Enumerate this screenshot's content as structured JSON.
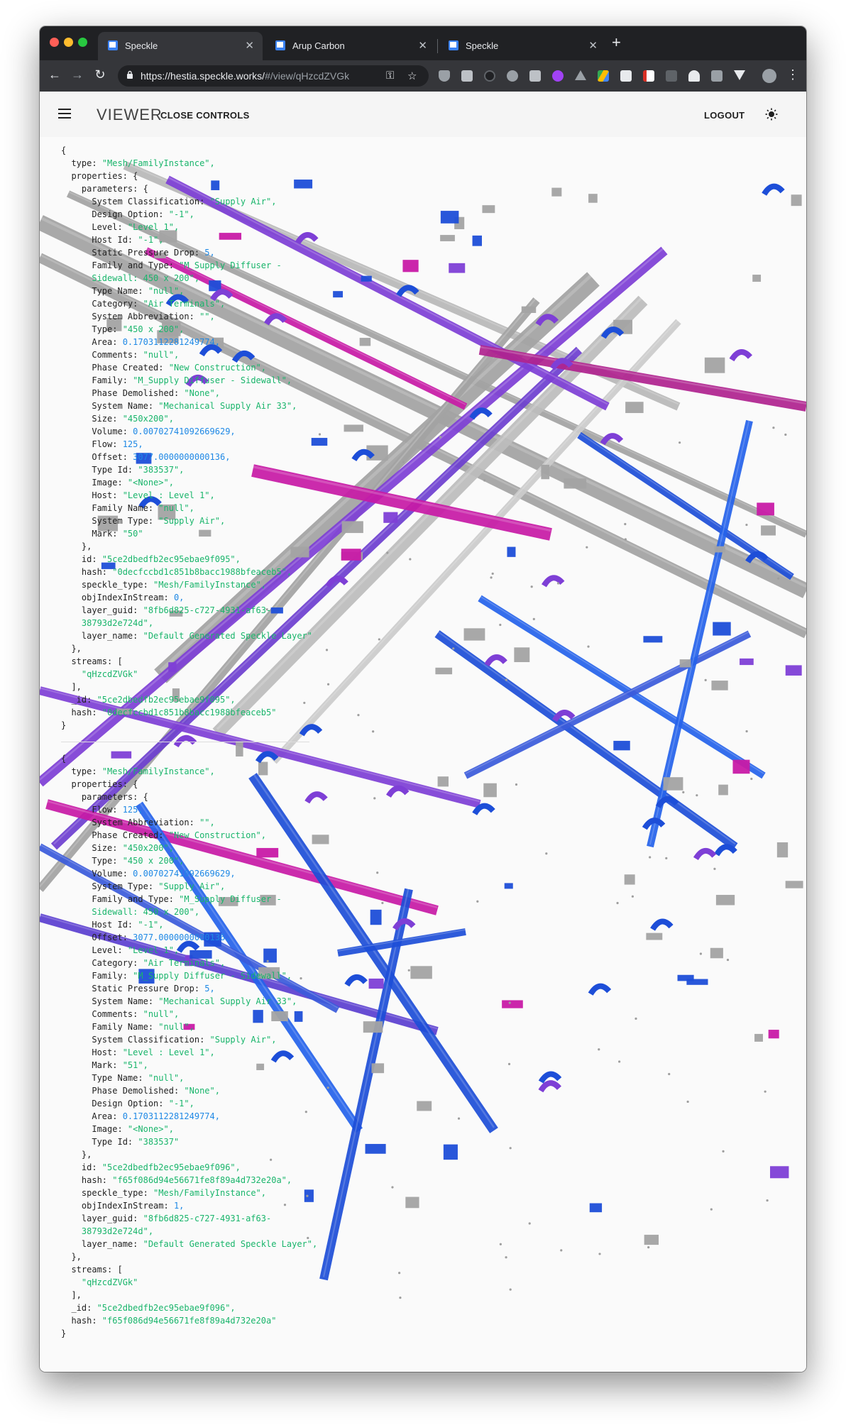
{
  "browser": {
    "tabs": [
      {
        "title": "Speckle",
        "active": true
      },
      {
        "title": "Arup Carbon",
        "active": false
      },
      {
        "title": "Speckle",
        "active": false
      }
    ],
    "url_main": "https://hestia.speckle.works/",
    "url_rest": "#/view/qHzcdZVGk"
  },
  "appbar": {
    "title": "VIEWER",
    "close_controls": "CLOSE CONTROLS",
    "logout": "LOGOUT"
  },
  "colors": {
    "accent": "#1e88e5",
    "string_value": "#19b56b",
    "duct_blue": "#1d4ed8",
    "duct_purple": "#7e3fd6",
    "duct_magenta": "#c81aa6",
    "duct_gray": "#a3a3a3"
  },
  "objects": [
    {
      "lines": [
        [
          {
            "t": "p",
            "v": "{"
          }
        ],
        [
          {
            "t": "k",
            "v": "  type: "
          },
          {
            "t": "s",
            "v": "\"Mesh/FamilyInstance\","
          }
        ],
        [
          {
            "t": "k",
            "v": "  properties: {"
          }
        ],
        [
          {
            "t": "k",
            "v": "    parameters: {"
          }
        ],
        [
          {
            "t": "k",
            "v": "      System Classification: "
          },
          {
            "t": "s",
            "v": "\"Supply Air\","
          }
        ],
        [
          {
            "t": "k",
            "v": "      Design Option: "
          },
          {
            "t": "s",
            "v": "\"-1\","
          }
        ],
        [
          {
            "t": "k",
            "v": "      Level: "
          },
          {
            "t": "s",
            "v": "\"Level 1\","
          }
        ],
        [
          {
            "t": "k",
            "v": "      Host Id: "
          },
          {
            "t": "s",
            "v": "\"-1\","
          }
        ],
        [
          {
            "t": "k",
            "v": "      Static Pressure Drop: "
          },
          {
            "t": "n",
            "v": "5,"
          }
        ],
        [
          {
            "t": "k",
            "v": "      Family and Type: "
          },
          {
            "t": "s",
            "v": "\"M_Supply Diffuser -"
          }
        ],
        [
          {
            "t": "s",
            "v": "      Sidewall: 450 x 200\","
          }
        ],
        [
          {
            "t": "k",
            "v": "      Type Name: "
          },
          {
            "t": "s",
            "v": "\"null\","
          }
        ],
        [
          {
            "t": "k",
            "v": "      Category: "
          },
          {
            "t": "s",
            "v": "\"Air Terminals\","
          }
        ],
        [
          {
            "t": "k",
            "v": "      System Abbreviation: "
          },
          {
            "t": "s",
            "v": "\"\","
          }
        ],
        [
          {
            "t": "k",
            "v": "      Type: "
          },
          {
            "t": "s",
            "v": "\"450 x 200\","
          }
        ],
        [
          {
            "t": "k",
            "v": "      Area: "
          },
          {
            "t": "n",
            "v": "0.1703112281249774,"
          }
        ],
        [
          {
            "t": "k",
            "v": "      Comments: "
          },
          {
            "t": "s",
            "v": "\"null\","
          }
        ],
        [
          {
            "t": "k",
            "v": "      Phase Created: "
          },
          {
            "t": "s",
            "v": "\"New Construction\","
          }
        ],
        [
          {
            "t": "k",
            "v": "      Family: "
          },
          {
            "t": "s",
            "v": "\"M_Supply Diffuser - Sidewall\","
          }
        ],
        [
          {
            "t": "k",
            "v": "      Phase Demolished: "
          },
          {
            "t": "s",
            "v": "\"None\","
          }
        ],
        [
          {
            "t": "k",
            "v": "      System Name: "
          },
          {
            "t": "s",
            "v": "\"Mechanical Supply Air 33\","
          }
        ],
        [
          {
            "t": "k",
            "v": "      Size: "
          },
          {
            "t": "s",
            "v": "\"450x200\","
          }
        ],
        [
          {
            "t": "k",
            "v": "      Volume: "
          },
          {
            "t": "n",
            "v": "0.00702741092669629,"
          }
        ],
        [
          {
            "t": "k",
            "v": "      Flow: "
          },
          {
            "t": "n",
            "v": "125,"
          }
        ],
        [
          {
            "t": "k",
            "v": "      Offset: "
          },
          {
            "t": "n",
            "v": "3077.0000000000136,"
          }
        ],
        [
          {
            "t": "k",
            "v": "      Type Id: "
          },
          {
            "t": "s",
            "v": "\"383537\","
          }
        ],
        [
          {
            "t": "k",
            "v": "      Image: "
          },
          {
            "t": "s",
            "v": "\"<None>\","
          }
        ],
        [
          {
            "t": "k",
            "v": "      Host: "
          },
          {
            "t": "s",
            "v": "\"Level : Level 1\","
          }
        ],
        [
          {
            "t": "k",
            "v": "      Family Name: "
          },
          {
            "t": "s",
            "v": "\"null\","
          }
        ],
        [
          {
            "t": "k",
            "v": "      System Type: "
          },
          {
            "t": "s",
            "v": "\"Supply Air\","
          }
        ],
        [
          {
            "t": "k",
            "v": "      Mark: "
          },
          {
            "t": "s",
            "v": "\"50\""
          }
        ],
        [
          {
            "t": "k",
            "v": "    },"
          }
        ],
        [
          {
            "t": "k",
            "v": "    id: "
          },
          {
            "t": "s",
            "v": "\"5ce2dbedfb2ec95ebae9f095\","
          }
        ],
        [
          {
            "t": "k",
            "v": "    hash: "
          },
          {
            "t": "s",
            "v": "\"0decfccbd1c851b8bacc1988bfeaceb5\","
          }
        ],
        [
          {
            "t": "k",
            "v": "    speckle_type: "
          },
          {
            "t": "s",
            "v": "\"Mesh/FamilyInstance\","
          }
        ],
        [
          {
            "t": "k",
            "v": "    objIndexInStream: "
          },
          {
            "t": "n",
            "v": "0,"
          }
        ],
        [
          {
            "t": "k",
            "v": "    layer_guid: "
          },
          {
            "t": "s",
            "v": "\"8fb6d825-c727-4931-af63-"
          }
        ],
        [
          {
            "t": "s",
            "v": "    38793d2e724d\","
          }
        ],
        [
          {
            "t": "k",
            "v": "    layer_name: "
          },
          {
            "t": "s",
            "v": "\"Default Generated Speckle Layer\""
          }
        ],
        [
          {
            "t": "k",
            "v": "  },"
          }
        ],
        [
          {
            "t": "k",
            "v": "  streams: ["
          }
        ],
        [
          {
            "t": "s",
            "v": "    \"qHzcdZVGk\""
          }
        ],
        [
          {
            "t": "k",
            "v": "  ],"
          }
        ],
        [
          {
            "t": "k",
            "v": "  _id: "
          },
          {
            "t": "s",
            "v": "\"5ce2dbedfb2ec95ebae9f095\","
          }
        ],
        [
          {
            "t": "k",
            "v": "  hash: "
          },
          {
            "t": "s",
            "v": "\"0decfccbd1c851b8bacc1988bfeaceb5\""
          }
        ],
        [
          {
            "t": "p",
            "v": "}"
          }
        ]
      ]
    },
    {
      "lines": [
        [
          {
            "t": "p",
            "v": "{"
          }
        ],
        [
          {
            "t": "k",
            "v": "  type: "
          },
          {
            "t": "s",
            "v": "\"Mesh/FamilyInstance\","
          }
        ],
        [
          {
            "t": "k",
            "v": "  properties: {"
          }
        ],
        [
          {
            "t": "k",
            "v": "    parameters: {"
          }
        ],
        [
          {
            "t": "k",
            "v": "      Flow: "
          },
          {
            "t": "n",
            "v": "125,"
          }
        ],
        [
          {
            "t": "k",
            "v": "      System Abbreviation: "
          },
          {
            "t": "s",
            "v": "\"\","
          }
        ],
        [
          {
            "t": "k",
            "v": "      Phase Created: "
          },
          {
            "t": "s",
            "v": "\"New Construction\","
          }
        ],
        [
          {
            "t": "k",
            "v": "      Size: "
          },
          {
            "t": "s",
            "v": "\"450x200\","
          }
        ],
        [
          {
            "t": "k",
            "v": "      Type: "
          },
          {
            "t": "s",
            "v": "\"450 x 200\","
          }
        ],
        [
          {
            "t": "k",
            "v": "      Volume: "
          },
          {
            "t": "n",
            "v": "0.00702741092669629,"
          }
        ],
        [
          {
            "t": "k",
            "v": "      System Type: "
          },
          {
            "t": "s",
            "v": "\"Supply Air\","
          }
        ],
        [
          {
            "t": "k",
            "v": "      Family and Type: "
          },
          {
            "t": "s",
            "v": "\"M_Supply Diffuser -"
          }
        ],
        [
          {
            "t": "s",
            "v": "      Sidewall: 450 x 200\","
          }
        ],
        [
          {
            "t": "k",
            "v": "      Host Id: "
          },
          {
            "t": "s",
            "v": "\"-1\","
          }
        ],
        [
          {
            "t": "k",
            "v": "      Offset: "
          },
          {
            "t": "n",
            "v": "3077.0000000000136,"
          }
        ],
        [
          {
            "t": "k",
            "v": "      Level: "
          },
          {
            "t": "s",
            "v": "\"Level 1\","
          }
        ],
        [
          {
            "t": "k",
            "v": "      Category: "
          },
          {
            "t": "s",
            "v": "\"Air Terminals\","
          }
        ],
        [
          {
            "t": "k",
            "v": "      Family: "
          },
          {
            "t": "s",
            "v": "\"M_Supply Diffuser - Sidewall\","
          }
        ],
        [
          {
            "t": "k",
            "v": "      Static Pressure Drop: "
          },
          {
            "t": "n",
            "v": "5,"
          }
        ],
        [
          {
            "t": "k",
            "v": "      System Name: "
          },
          {
            "t": "s",
            "v": "\"Mechanical Supply Air 33\","
          }
        ],
        [
          {
            "t": "k",
            "v": "      Comments: "
          },
          {
            "t": "s",
            "v": "\"null\","
          }
        ],
        [
          {
            "t": "k",
            "v": "      Family Name: "
          },
          {
            "t": "s",
            "v": "\"null\","
          }
        ],
        [
          {
            "t": "k",
            "v": "      System Classification: "
          },
          {
            "t": "s",
            "v": "\"Supply Air\","
          }
        ],
        [
          {
            "t": "k",
            "v": "      Host: "
          },
          {
            "t": "s",
            "v": "\"Level : Level 1\","
          }
        ],
        [
          {
            "t": "k",
            "v": "      Mark: "
          },
          {
            "t": "s",
            "v": "\"51\","
          }
        ],
        [
          {
            "t": "k",
            "v": "      Type Name: "
          },
          {
            "t": "s",
            "v": "\"null\","
          }
        ],
        [
          {
            "t": "k",
            "v": "      Phase Demolished: "
          },
          {
            "t": "s",
            "v": "\"None\","
          }
        ],
        [
          {
            "t": "k",
            "v": "      Design Option: "
          },
          {
            "t": "s",
            "v": "\"-1\","
          }
        ],
        [
          {
            "t": "k",
            "v": "      Area: "
          },
          {
            "t": "n",
            "v": "0.1703112281249774,"
          }
        ],
        [
          {
            "t": "k",
            "v": "      Image: "
          },
          {
            "t": "s",
            "v": "\"<None>\","
          }
        ],
        [
          {
            "t": "k",
            "v": "      Type Id: "
          },
          {
            "t": "s",
            "v": "\"383537\""
          }
        ],
        [
          {
            "t": "k",
            "v": "    },"
          }
        ],
        [
          {
            "t": "k",
            "v": "    id: "
          },
          {
            "t": "s",
            "v": "\"5ce2dbedfb2ec95ebae9f096\","
          }
        ],
        [
          {
            "t": "k",
            "v": "    hash: "
          },
          {
            "t": "s",
            "v": "\"f65f086d94e56671fe8f89a4d732e20a\","
          }
        ],
        [
          {
            "t": "k",
            "v": "    speckle_type: "
          },
          {
            "t": "s",
            "v": "\"Mesh/FamilyInstance\","
          }
        ],
        [
          {
            "t": "k",
            "v": "    objIndexInStream: "
          },
          {
            "t": "n",
            "v": "1,"
          }
        ],
        [
          {
            "t": "k",
            "v": "    layer_guid: "
          },
          {
            "t": "s",
            "v": "\"8fb6d825-c727-4931-af63-"
          }
        ],
        [
          {
            "t": "s",
            "v": "    38793d2e724d\","
          }
        ],
        [
          {
            "t": "k",
            "v": "    layer_name: "
          },
          {
            "t": "s",
            "v": "\"Default Generated Speckle Layer\","
          }
        ],
        [
          {
            "t": "k",
            "v": "  },"
          }
        ],
        [
          {
            "t": "k",
            "v": "  streams: ["
          }
        ],
        [
          {
            "t": "s",
            "v": "    \"qHzcdZVGk\""
          }
        ],
        [
          {
            "t": "k",
            "v": "  ],"
          }
        ],
        [
          {
            "t": "k",
            "v": "  _id: "
          },
          {
            "t": "s",
            "v": "\"5ce2dbedfb2ec95ebae9f096\","
          }
        ],
        [
          {
            "t": "k",
            "v": "  hash: "
          },
          {
            "t": "s",
            "v": "\"f65f086d94e56671fe8f89a4d732e20a\""
          }
        ],
        [
          {
            "t": "p",
            "v": "}"
          }
        ]
      ]
    }
  ]
}
